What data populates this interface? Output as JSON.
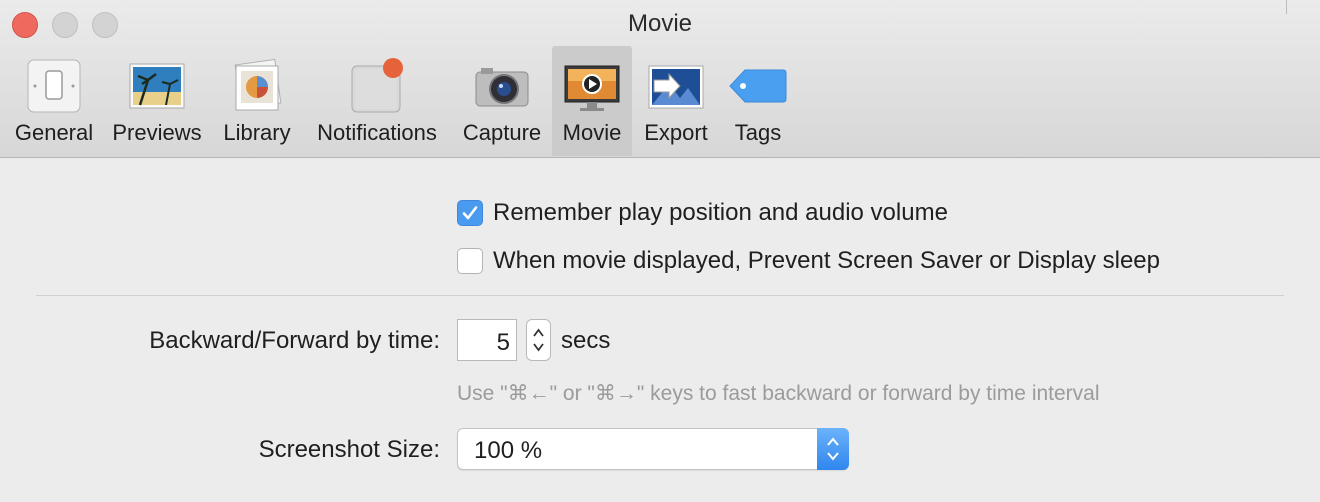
{
  "window": {
    "title": "Movie"
  },
  "toolbar": {
    "items": [
      {
        "label": "General",
        "icon": "light-switch-icon",
        "selected": false
      },
      {
        "label": "Previews",
        "icon": "beach-photo-icon",
        "selected": false
      },
      {
        "label": "Library",
        "icon": "photo-library-icon",
        "selected": false
      },
      {
        "label": "Notifications",
        "icon": "notifications-badge-icon",
        "selected": false
      },
      {
        "label": "Capture",
        "icon": "camera-icon",
        "selected": false
      },
      {
        "label": "Movie",
        "icon": "movie-player-icon",
        "selected": true
      },
      {
        "label": "Export",
        "icon": "export-arrow-icon",
        "selected": false
      },
      {
        "label": "Tags",
        "icon": "tag-icon",
        "selected": false
      }
    ]
  },
  "options": {
    "remember_label": "Remember play position and audio volume",
    "remember_checked": true,
    "prevent_sleep_label": "When movie displayed, Prevent Screen Saver or Display sleep",
    "prevent_sleep_checked": false
  },
  "seek": {
    "label": "Backward/Forward by time:",
    "value": "5",
    "unit": "secs",
    "hint": "Use \"⌘←\" or \"⌘→\" keys to fast backward or forward by time interval"
  },
  "screenshot": {
    "label": "Screenshot Size:",
    "value": "100 %"
  },
  "colors": {
    "accent": "#4a9bf0",
    "close": "#ee6a5e",
    "notification_badge": "#e5623a",
    "tag_blue": "#4a9ff0"
  }
}
